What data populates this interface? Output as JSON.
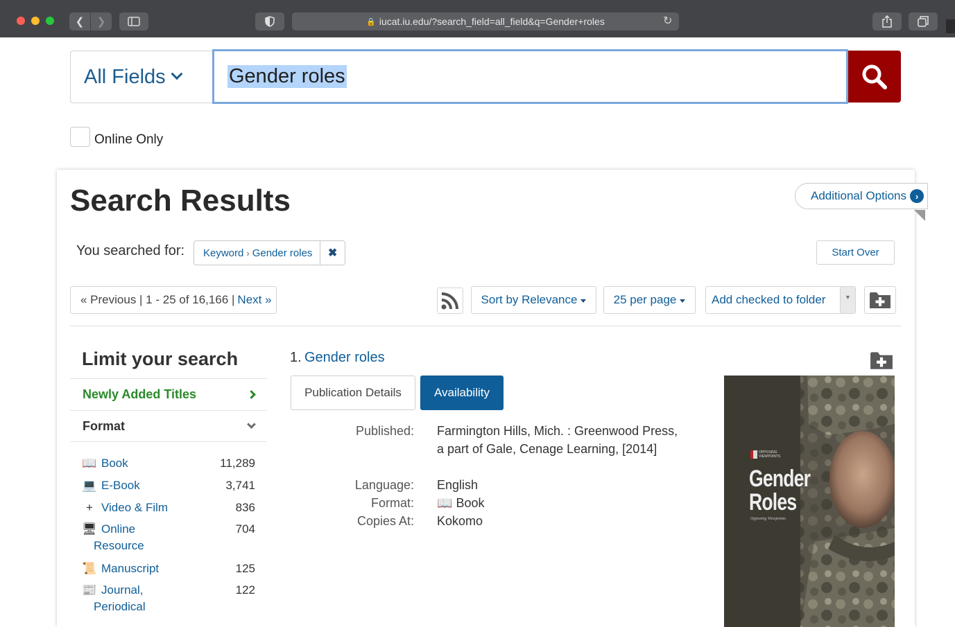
{
  "browser": {
    "url": "iucat.iu.edu/?search_field=all_field&q=Gender+roles"
  },
  "search": {
    "field_select": "All Fields",
    "query": "Gender roles",
    "online_only_label": "Online Only"
  },
  "results": {
    "title": "Search Results",
    "additional_options": "Additional Options",
    "searched_for_label": "You searched for:",
    "constraint_field": "Keyword",
    "constraint_value": "Gender roles",
    "start_over": "Start Over",
    "pager_prev": "« Previous | 1 - 25 of 16,166 |",
    "pager_next": "Next »",
    "sort": "Sort by Relevance",
    "per_page": "25 per page",
    "folder_select": "Add checked to folder"
  },
  "facets": {
    "title": "Limit your search",
    "newly_added": "Newly Added Titles",
    "format": "Format",
    "items": [
      {
        "label": "Book",
        "count": "11,289",
        "icon": "book-icon",
        "glyph": "📖"
      },
      {
        "label": "E-Book",
        "count": "3,741",
        "icon": "ebook-icon",
        "glyph": "💻"
      },
      {
        "label": "Video & Film",
        "count": "836",
        "icon": "plus-icon",
        "glyph": "+"
      },
      {
        "label": "Online",
        "label2": "Resource",
        "count": "704",
        "icon": "monitor-icon",
        "glyph": "🖥"
      },
      {
        "label": "Manuscript",
        "count": "125",
        "icon": "manuscript-icon",
        "glyph": "📜"
      },
      {
        "label": "Journal,",
        "label2": "Periodical",
        "count": "122",
        "icon": "journal-icon",
        "glyph": "📰"
      }
    ]
  },
  "record": {
    "number": "1.",
    "title": "Gender roles",
    "tab_details": "Publication Details",
    "tab_availability": "Availability",
    "published_label": "Published:",
    "published": "Farmington Hills, Mich. : Greenwood Press, a part of Gale, Cenage Learning, [2014]",
    "language_label": "Language:",
    "language": "English",
    "format_label": "Format:",
    "format": "Book",
    "copies_label": "Copies At:",
    "copies": "Kokomo",
    "cover_series": "OPPOSING VIEWPOINTS",
    "cover_title_1": "Gender",
    "cover_title_2": "Roles",
    "cover_subtitle": "Opposing Viewpoints"
  },
  "colors": {
    "link": "#0f5e99",
    "search_button": "#990000",
    "facet_new": "#2a8a2a",
    "availability_tab": "#0f5e99"
  }
}
